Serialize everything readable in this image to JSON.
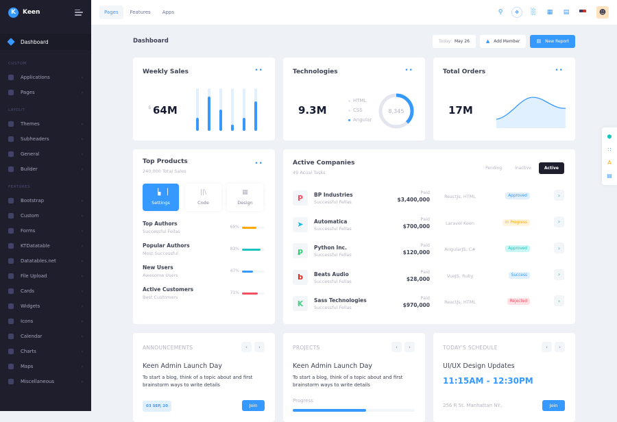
{
  "app": {
    "name": "Keen",
    "logo_letter": "K"
  },
  "sidebar": {
    "active": "Dashboard",
    "sections": [
      {
        "title": "CUSTOM",
        "items": [
          {
            "label": "Applications",
            "icon": "app-icon"
          },
          {
            "label": "Pages",
            "icon": "pages-icon"
          }
        ]
      },
      {
        "title": "LAYOUT",
        "items": [
          {
            "label": "Themes",
            "icon": "themes-icon"
          },
          {
            "label": "Subheaders",
            "icon": "subheaders-icon"
          },
          {
            "label": "General",
            "icon": "general-icon"
          },
          {
            "label": "Builder",
            "icon": "builder-icon"
          }
        ]
      },
      {
        "title": "FEATURES",
        "items": [
          {
            "label": "Bootstrap"
          },
          {
            "label": "Custom"
          },
          {
            "label": "Forms"
          },
          {
            "label": "KTDatatable"
          },
          {
            "label": "Datatables.net"
          },
          {
            "label": "File Upload"
          },
          {
            "label": "Cards"
          },
          {
            "label": "Widgets"
          },
          {
            "label": "Icons"
          },
          {
            "label": "Calendar"
          },
          {
            "label": "Charts"
          },
          {
            "label": "Maps"
          },
          {
            "label": "Miscellaneous"
          }
        ]
      }
    ]
  },
  "topbar": {
    "tabs": [
      {
        "label": "Pages",
        "active": true
      },
      {
        "label": "Features"
      },
      {
        "label": "Apps"
      }
    ],
    "icons": [
      "search-icon",
      "compass-icon",
      "chart-icon",
      "apps-grid-icon",
      "chat-icon",
      "us-flag-icon",
      "user-avatar"
    ]
  },
  "subheader": {
    "title": "Dashboard",
    "today_label": "Today:",
    "today_value": "May 26",
    "add_member": "Add Member",
    "new_report": "New Report"
  },
  "weekly_sales": {
    "title": "Weekly Sales",
    "currency": "$",
    "value": "64M",
    "bar_fractions": [
      0.3,
      0.8,
      0.5,
      0.15,
      0.3,
      0.7
    ]
  },
  "technologies": {
    "title": "Technologies",
    "value": "9.3M",
    "legend": [
      "HTML",
      "CSS",
      "Angular"
    ],
    "center": "8,345",
    "donut_fraction": 0.38,
    "accent": "#3699ff"
  },
  "total_orders": {
    "title": "Total Orders",
    "value": "17M"
  },
  "top_products": {
    "title": "Top Products",
    "subtitle": "240,000 Total Sales",
    "buttons": [
      {
        "label": "Settings",
        "active": true
      },
      {
        "label": "Code"
      },
      {
        "label": "Design"
      }
    ],
    "authors": [
      {
        "name": "Top Authors",
        "sub": "Successful Fellas",
        "pct": "65%",
        "value": 0.65,
        "color": "#ffa800"
      },
      {
        "name": "Popular Authors",
        "sub": "Most Successful",
        "pct": "83%",
        "value": 0.83,
        "color": "#1bc5bd"
      },
      {
        "name": "New Users",
        "sub": "Awesome Users",
        "pct": "47%",
        "value": 0.47,
        "color": "#3699ff"
      },
      {
        "name": "Active Customers",
        "sub": "Best Customers",
        "pct": "71%",
        "value": 0.71,
        "color": "#f64e60"
      }
    ]
  },
  "active_companies": {
    "title": "Active Companies",
    "subtitle": "49 Acual Tasks",
    "tabs": [
      {
        "label": "Pending"
      },
      {
        "label": "Inactive"
      },
      {
        "label": "Active",
        "active": true
      }
    ],
    "paid_label": "Paid",
    "rows": [
      {
        "name": "BP Industries",
        "sub": "Successful Fellas",
        "amount": "$3,400,000",
        "tech": "ReactJs, HTML",
        "status": "Approved",
        "badge_bg": "#e1f0ff",
        "badge_fg": "#3699ff",
        "logo": "P",
        "logo_color": "#f64e60"
      },
      {
        "name": "Automatica",
        "sub": "Successful Fellas",
        "amount": "$700,000",
        "tech": "Laravel Keen",
        "status": "In Progress",
        "badge_bg": "#fff4de",
        "badge_fg": "#ffa800",
        "logo": "➤",
        "logo_color": "#1bb6e6"
      },
      {
        "name": "Python Inc.",
        "sub": "Successful Fellas",
        "amount": "$120,000",
        "tech": "AngularJS, C#",
        "status": "Approved",
        "badge_bg": "#c9f7f5",
        "badge_fg": "#1bc5bd",
        "logo": "ꝑ",
        "logo_color": "#2ecc71"
      },
      {
        "name": "Beats Audio",
        "sub": "Successful Fellas",
        "amount": "$28,000",
        "tech": "VueJS, Ruby",
        "status": "Success",
        "badge_bg": "#e1f0ff",
        "badge_fg": "#3699ff",
        "logo": "b",
        "logo_color": "#e2231a"
      },
      {
        "name": "Sass Technologies",
        "sub": "Successful Fellas",
        "amount": "$970,000",
        "tech": "ReactJs, HTML",
        "status": "Rejected",
        "badge_bg": "#ffe2e5",
        "badge_fg": "#f64e60",
        "logo": "K",
        "logo_color": "#50cd89"
      }
    ]
  },
  "announcements": {
    "heading": "ANNOUNCEMENTS",
    "title": "Keen Admin Launch Day",
    "text": "To start a blog, think of a topic about and first brainstorm ways to write details",
    "date": "03 SEP, 20",
    "join": "Join"
  },
  "projects": {
    "heading": "PROJECTS",
    "title": "Keen Admin Launch Day",
    "text": "To start a blog, think of a topic about and first brainstorm ways to write details",
    "progress_label": "Progress",
    "progress": 0.6
  },
  "schedule": {
    "heading": "TODAY'S SCHEDULE",
    "title": "UI/UX Design Updates",
    "time": "11:15AM - 12:30PM",
    "address": "256 R St. Manhattan NY..",
    "join": "Join"
  },
  "nav_prev": "‹",
  "nav_next": "›"
}
